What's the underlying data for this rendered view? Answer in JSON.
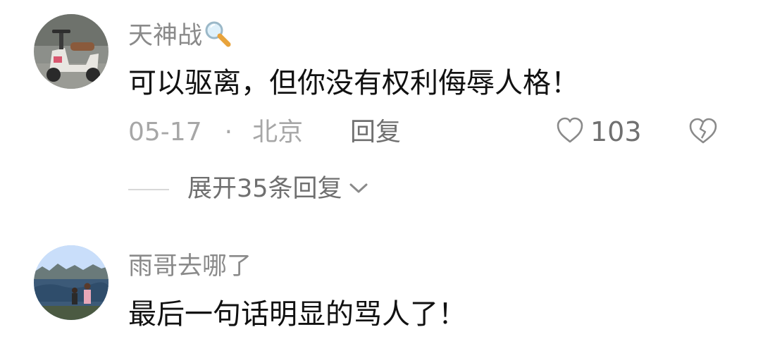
{
  "comments": [
    {
      "username": "天神战",
      "text": "可以驱离，但你没有权利侮辱人格！",
      "date": "05-17",
      "separator": "·",
      "location": "北京",
      "reply_label": "回复",
      "like_count": "103",
      "avatar_icon": "scooter-avatar",
      "name_suffix_icon": "magnifier-emoji"
    },
    {
      "username": "雨哥去哪了",
      "text": "最后一句话明显的骂人了！",
      "avatar_icon": "outdoor-photo-avatar"
    }
  ],
  "expand_replies": {
    "label": "展开35条回复",
    "icon": "chevron-down-icon"
  },
  "colors": {
    "username": "#8a8a8a",
    "text": "#111111",
    "meta": "#a7a7a7",
    "action": "#707070"
  }
}
